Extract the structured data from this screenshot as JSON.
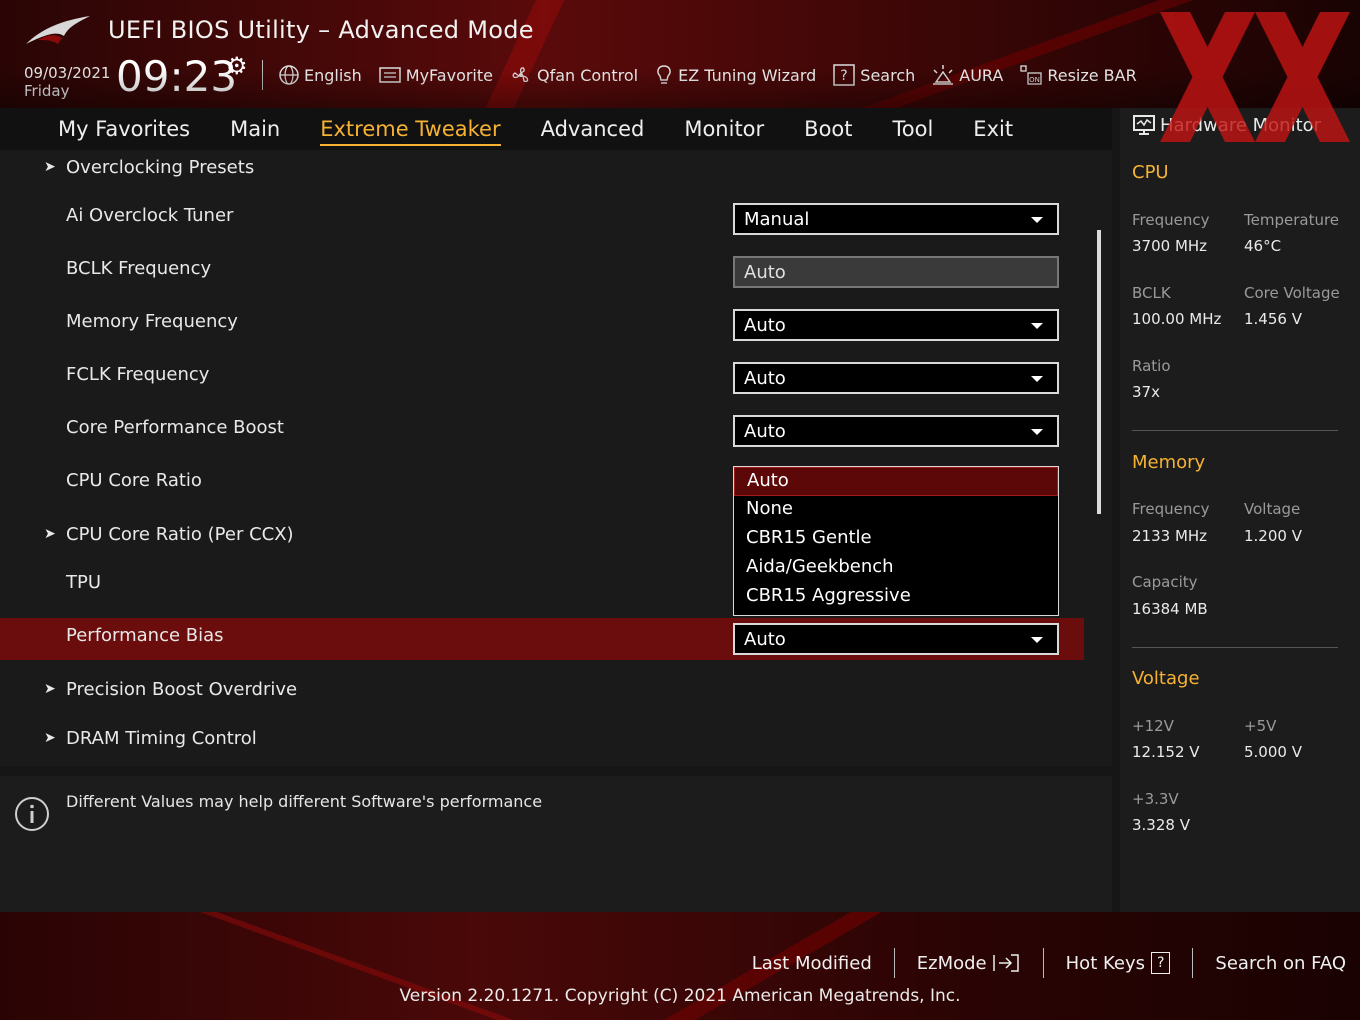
{
  "header": {
    "title": "UEFI BIOS Utility – Advanced Mode",
    "date": "09/03/2021",
    "day": "Friday",
    "time": "09:23",
    "toolbar": [
      {
        "label": "English",
        "icon": "globe-icon"
      },
      {
        "label": "MyFavorite",
        "icon": "favorite-list-icon"
      },
      {
        "label": "Qfan Control",
        "icon": "fan-icon"
      },
      {
        "label": "EZ Tuning Wizard",
        "icon": "lightbulb-icon"
      },
      {
        "label": "Search",
        "icon": "help-search-icon"
      },
      {
        "label": "AURA",
        "icon": "aura-light-icon"
      },
      {
        "label": "Resize BAR",
        "icon": "resize-bar-icon"
      }
    ]
  },
  "tabs": [
    "My Favorites",
    "Main",
    "Extreme Tweaker",
    "Advanced",
    "Monitor",
    "Boot",
    "Tool",
    "Exit"
  ],
  "active_tab": "Extreme Tweaker",
  "settings": [
    {
      "label": "Overclocking Presets",
      "submenu": true
    },
    {
      "label": "Ai Overclock Tuner",
      "value": "Manual"
    },
    {
      "label": "BCLK Frequency",
      "value": "Auto",
      "input": true
    },
    {
      "label": "Memory Frequency",
      "value": "Auto"
    },
    {
      "label": "FCLK Frequency",
      "value": "Auto"
    },
    {
      "label": "Core Performance Boost",
      "value": "Auto"
    },
    {
      "label": "CPU Core Ratio"
    },
    {
      "label": "CPU Core Ratio (Per CCX)",
      "submenu": true
    },
    {
      "label": "TPU"
    },
    {
      "label": "Performance Bias",
      "value": "Auto",
      "selected": true
    },
    {
      "label": "Precision Boost Overdrive",
      "submenu": true
    },
    {
      "label": "DRAM Timing Control",
      "submenu": true
    }
  ],
  "dropdown_open": {
    "options": [
      "Auto",
      "None",
      "CBR15 Gentle",
      "Aida/Geekbench",
      "CBR15 Aggressive"
    ],
    "highlighted": "Auto"
  },
  "info": "Different Values may help different Software's performance",
  "hardware_monitor": {
    "title": "Hardware Monitor",
    "cpu": {
      "heading": "CPU",
      "frequency_label": "Frequency",
      "frequency": "3700 MHz",
      "temperature_label": "Temperature",
      "temperature": "46°C",
      "bclk_label": "BCLK",
      "bclk": "100.00 MHz",
      "core_voltage_label": "Core Voltage",
      "core_voltage": "1.456 V",
      "ratio_label": "Ratio",
      "ratio": "37x"
    },
    "memory": {
      "heading": "Memory",
      "frequency_label": "Frequency",
      "frequency": "2133 MHz",
      "voltage_label": "Voltage",
      "voltage": "1.200 V",
      "capacity_label": "Capacity",
      "capacity": "16384 MB"
    },
    "voltage": {
      "heading": "Voltage",
      "v12_label": "+12V",
      "v12": "12.152 V",
      "v5_label": "+5V",
      "v5": "5.000 V",
      "v33_label": "+3.3V",
      "v33": "3.328 V"
    }
  },
  "footer": {
    "last_modified": "Last Modified",
    "ezmode": "EzMode",
    "hot_keys": "Hot Keys",
    "hot_keys_box": "?",
    "search_faq": "Search on FAQ",
    "version": "Version 2.20.1271. Copyright (C) 2021 American Megatrends, Inc."
  },
  "colors": {
    "accent": "#f5b233",
    "selected_row": "#6b0d0d",
    "header_red": "#5a0a0a"
  }
}
